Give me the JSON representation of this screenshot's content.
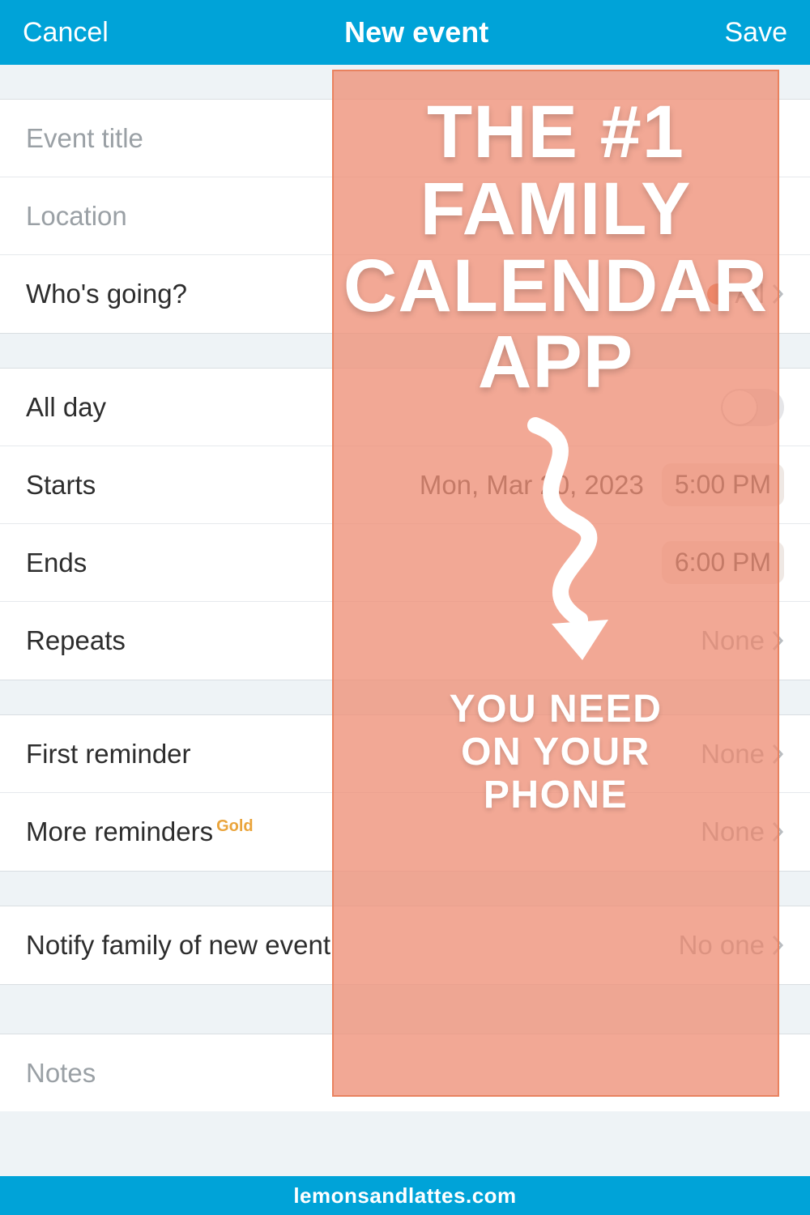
{
  "navbar": {
    "cancel": "Cancel",
    "title": "New event",
    "save": "Save"
  },
  "fields": {
    "event_title_placeholder": "Event title",
    "location_placeholder": "Location",
    "whos_going_label": "Who's going?",
    "whos_going_value": "All",
    "all_day_label": "All day",
    "all_day_on": false,
    "starts_label": "Starts",
    "starts_date": "Mon, Mar 20, 2023",
    "starts_time": "5:00 PM",
    "ends_label": "Ends",
    "ends_time": "6:00 PM",
    "repeats_label": "Repeats",
    "repeats_value": "None",
    "first_reminder_label": "First reminder",
    "first_reminder_value": "None",
    "more_reminders_label": "More reminders",
    "more_reminders_badge": "Gold",
    "more_reminders_value": "None",
    "notify_label": "Notify family of new event",
    "notify_value": "No one",
    "notes_placeholder": "Notes"
  },
  "overlay": {
    "headline_lines": [
      "THE #1",
      "FAMILY",
      "CALENDAR",
      "APP"
    ],
    "sub_lines": [
      "YOU NEED",
      "ON YOUR",
      "PHONE"
    ]
  },
  "footer": {
    "site": "lemonsandlattes.com"
  }
}
